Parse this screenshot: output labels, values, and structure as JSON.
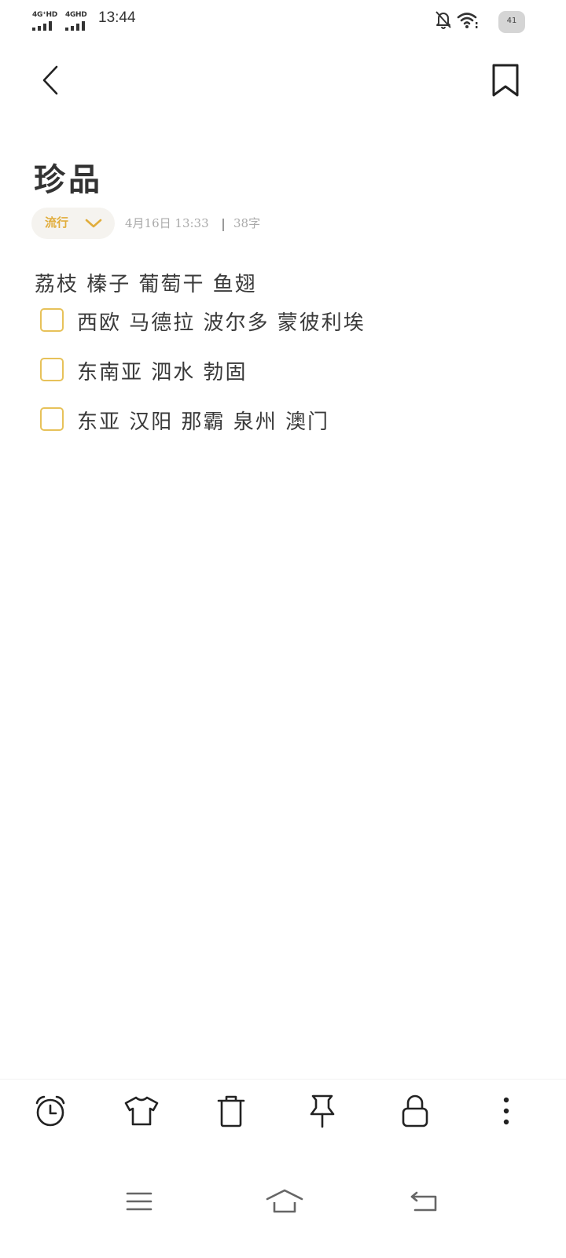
{
  "status_bar": {
    "signal_1": "4G⁺HD",
    "signal_2": "4GHD",
    "time": "13:44",
    "battery_level": "41",
    "icons": [
      "bell-off-icon",
      "wifi-icon",
      "battery-icon"
    ]
  },
  "header": {
    "back_icon": "chevron-left-icon",
    "bookmark_icon": "bookmark-icon"
  },
  "note": {
    "title": "珍品",
    "category": "流行",
    "date": "4月16日 13:33",
    "word_count": "38字",
    "paragraph": "荔枝 榛子 葡萄干 鱼翅",
    "checklist": [
      {
        "text": "西欧 马德拉 波尔多 蒙彼利埃",
        "checked": false
      },
      {
        "text": "东南亚 泗水 勃固",
        "checked": false
      },
      {
        "text": "东亚 汉阳 那霸 泉州 澳门",
        "checked": false
      }
    ]
  },
  "colors": {
    "accent": "#e7c25a",
    "category_text": "#e1ad3c",
    "category_bg": "#f5f3ef",
    "meta_text": "#aaaaaa",
    "text": "#333333"
  },
  "toolbar": {
    "items": [
      "alarm-clock-icon",
      "shirt-icon",
      "trash-icon",
      "pin-icon",
      "lock-icon",
      "more-vertical-icon"
    ]
  },
  "nav_bar": {
    "items": [
      "menu-icon",
      "home-icon",
      "back-icon"
    ]
  }
}
